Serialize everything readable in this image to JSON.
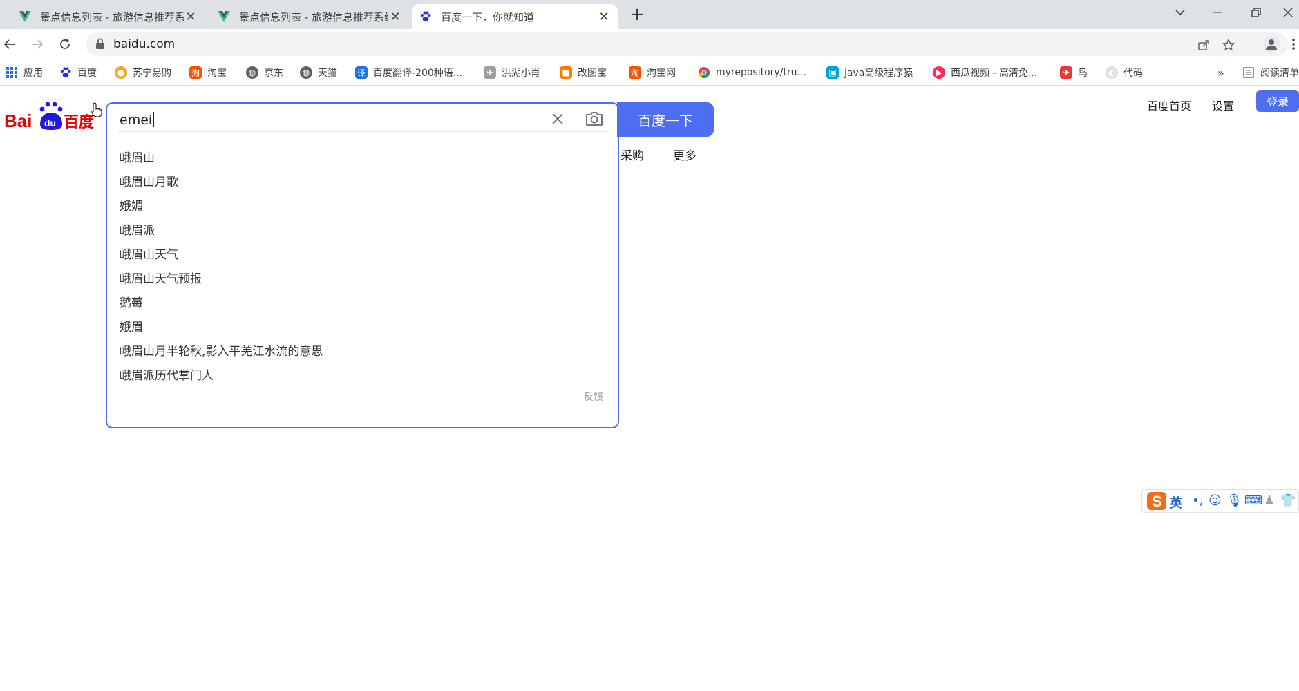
{
  "tabs": [
    {
      "title": "景点信息列表 - 旅游信息推荐系统",
      "favicon": "vue-icon"
    },
    {
      "title": "景点信息列表 - 旅游信息推荐系统",
      "favicon": "vue-icon"
    },
    {
      "title": "百度一下，你就知道",
      "favicon": "baidu-paw-icon",
      "active": true
    }
  ],
  "address_bar": {
    "url": "baidu.com"
  },
  "bookmarks": [
    {
      "label": "应用",
      "icon": "apps-grid-icon",
      "color": "#1a73e8"
    },
    {
      "label": "百度",
      "icon": "baidu-paw-icon",
      "color": "#2932e1"
    },
    {
      "label": "苏宁易购",
      "icon": "suning-lion-icon",
      "color": "#f5a623"
    },
    {
      "label": "淘宝",
      "icon": "taobao-icon",
      "color": "#ff5000"
    },
    {
      "label": "京东",
      "icon": "globe-icon",
      "color": "#5f6368"
    },
    {
      "label": "天猫",
      "icon": "globe-icon",
      "color": "#5f6368"
    },
    {
      "label": "百度翻译-200种语...",
      "icon": "translate-icon",
      "color": "#1a73e8"
    },
    {
      "label": "洪湖小肖",
      "icon": "bird-icon",
      "color": "#7a7a7a"
    },
    {
      "label": "改图宝",
      "icon": "gaitubao-icon",
      "color": "#ff7a00"
    },
    {
      "label": "淘宝网",
      "icon": "taobao-icon",
      "color": "#ff5000"
    },
    {
      "label": "myrepository/tru...",
      "icon": "chrome-icon",
      "color": "#34a853"
    },
    {
      "label": "java高级程序猿",
      "icon": "bilibili-icon",
      "color": "#00a1d6"
    },
    {
      "label": "西瓜视频 - 高清免...",
      "icon": "xigua-icon",
      "color": "#fe2c55"
    },
    {
      "label": "鸟",
      "icon": "bird-icon",
      "color": "#e53935"
    },
    {
      "label": "代码",
      "icon": "moon-icon",
      "color": "#c7c7c7"
    }
  ],
  "reading_list": "阅读清单",
  "search": {
    "query": "emei",
    "suggestions": [
      "峨眉山",
      "峨眉山月歌",
      "娥媚",
      "峨眉派",
      "峨眉山天气",
      "峨眉山天气预报",
      "鹅莓",
      "娥眉",
      "峨眉山月半轮秋,影入平羌江水流的意思",
      "峨眉派历代掌门人"
    ],
    "feedback": "反馈",
    "button": "百度一下"
  },
  "behind_nav": {
    "partial": "采购",
    "more": "更多"
  },
  "top_nav": {
    "home": "百度首页",
    "settings": "设置",
    "login": "登录"
  },
  "ime": {
    "mode": "英"
  },
  "colors": {
    "accent": "#4e6ef2",
    "baidu_red": "#e10602",
    "baidu_blue": "#2319dc"
  }
}
